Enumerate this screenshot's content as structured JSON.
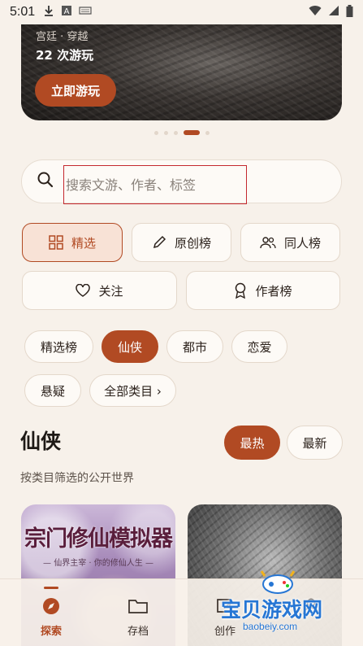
{
  "status_bar": {
    "time": "5:01"
  },
  "hero": {
    "tags": "宫廷 · 穿越",
    "plays": "22 次游玩",
    "play_label": "立即游玩"
  },
  "search": {
    "placeholder": "搜索文游、作者、标签"
  },
  "tabs": [
    {
      "label": "精选",
      "icon": "grid-icon",
      "active": true
    },
    {
      "label": "原创榜",
      "icon": "pencil-icon"
    },
    {
      "label": "同人榜",
      "icon": "people-icon"
    },
    {
      "label": "关注",
      "icon": "heart-icon"
    },
    {
      "label": "作者榜",
      "icon": "award-icon"
    }
  ],
  "categories": [
    {
      "label": "精选榜"
    },
    {
      "label": "仙侠",
      "active": true
    },
    {
      "label": "都市"
    },
    {
      "label": "恋爱"
    },
    {
      "label": "悬疑"
    },
    {
      "label": "全部类目 ›"
    }
  ],
  "section": {
    "title": "仙侠",
    "subtitle": "按类目筛选的公开世界",
    "sort": [
      {
        "label": "最热",
        "active": true
      },
      {
        "label": "最新"
      }
    ]
  },
  "cards": [
    {
      "title": "宗门修仙模拟器",
      "subtitle": "— 仙界主宰 · 你的修仙人生 —"
    },
    {
      "title": ""
    }
  ],
  "bottom_nav": [
    {
      "label": "探索",
      "icon": "compass-icon",
      "active": true
    },
    {
      "label": "存档",
      "icon": "folder-icon"
    },
    {
      "label": "创作",
      "icon": "create-icon"
    },
    {
      "label": "",
      "icon": "profile-icon"
    }
  ],
  "watermark": {
    "text": "宝贝游戏网",
    "url": "baobeiy.com"
  },
  "colors": {
    "accent": "#b14a23",
    "background": "#f7f1ea",
    "search_highlight": "#c4282e"
  }
}
